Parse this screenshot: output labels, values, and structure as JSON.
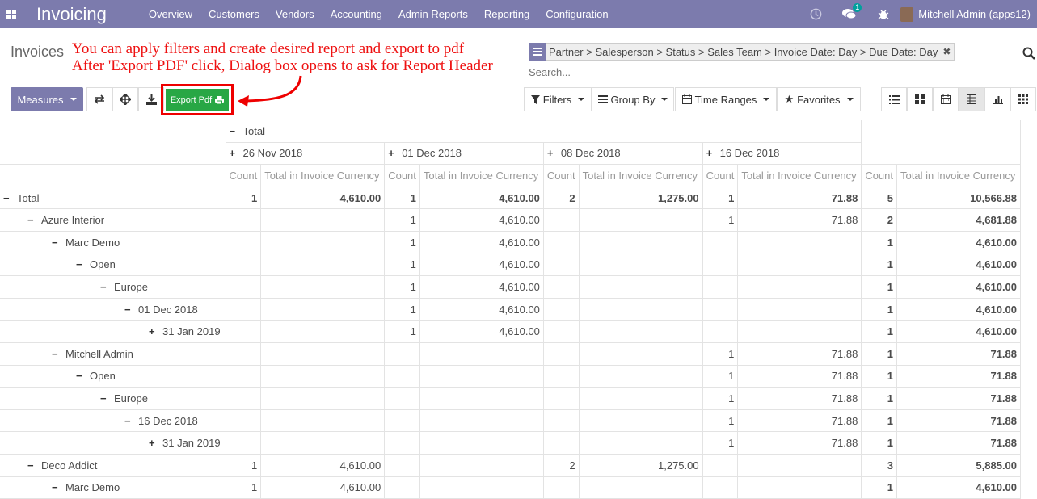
{
  "app": {
    "brand": "Invoicing",
    "menu": [
      "Overview",
      "Customers",
      "Vendors",
      "Accounting",
      "Admin Reports",
      "Reporting",
      "Configuration"
    ],
    "message_badge": "1",
    "user": "Mitchell Admin (apps12)"
  },
  "page": {
    "title": "Invoices",
    "annotation_line1": "You can apply filters and create desired report and export to pdf",
    "annotation_line2": "After 'Export PDF' click, Dialog box opens to ask for Report Header"
  },
  "search": {
    "facet": "Partner > Salesperson > Status > Sales Team > Invoice Date: Day > Due Date: Day",
    "placeholder": "Search..."
  },
  "toolbar": {
    "measures": "Measures",
    "export_pdf": "Export Pdf",
    "filters": "Filters",
    "group_by": "Group By",
    "time_ranges": "Time Ranges",
    "favorites": "Favorites"
  },
  "pivot": {
    "col_total": "Total",
    "col_groups": [
      "26 Nov 2018",
      "01 Dec 2018",
      "08 Dec 2018",
      "16 Dec 2018"
    ],
    "measure_count": "Count",
    "measure_total": "Total in Invoice Currency",
    "rows": [
      {
        "label": "Total",
        "indent": 0,
        "sign": "−",
        "bold": true,
        "cells": [
          "1",
          "4,610.00",
          "1",
          "4,610.00",
          "2",
          "1,275.00",
          "1",
          "71.88",
          "5",
          "10,566.88"
        ]
      },
      {
        "label": "Azure Interior",
        "indent": 1,
        "sign": "−",
        "bold": false,
        "cells": [
          "",
          "",
          "1",
          "4,610.00",
          "",
          "",
          "1",
          "71.88",
          "2",
          "4,681.88"
        ]
      },
      {
        "label": "Marc Demo",
        "indent": 2,
        "sign": "−",
        "bold": false,
        "cells": [
          "",
          "",
          "1",
          "4,610.00",
          "",
          "",
          "",
          "",
          "1",
          "4,610.00"
        ]
      },
      {
        "label": "Open",
        "indent": 3,
        "sign": "−",
        "bold": false,
        "cells": [
          "",
          "",
          "1",
          "4,610.00",
          "",
          "",
          "",
          "",
          "1",
          "4,610.00"
        ]
      },
      {
        "label": "Europe",
        "indent": 4,
        "sign": "−",
        "bold": false,
        "cells": [
          "",
          "",
          "1",
          "4,610.00",
          "",
          "",
          "",
          "",
          "1",
          "4,610.00"
        ]
      },
      {
        "label": "01 Dec 2018",
        "indent": 5,
        "sign": "−",
        "bold": false,
        "cells": [
          "",
          "",
          "1",
          "4,610.00",
          "",
          "",
          "",
          "",
          "1",
          "4,610.00"
        ]
      },
      {
        "label": "31 Jan 2019",
        "indent": 6,
        "sign": "+",
        "bold": false,
        "cells": [
          "",
          "",
          "1",
          "4,610.00",
          "",
          "",
          "",
          "",
          "1",
          "4,610.00"
        ]
      },
      {
        "label": "Mitchell Admin",
        "indent": 2,
        "sign": "−",
        "bold": false,
        "cells": [
          "",
          "",
          "",
          "",
          "",
          "",
          "1",
          "71.88",
          "1",
          "71.88"
        ]
      },
      {
        "label": "Open",
        "indent": 3,
        "sign": "−",
        "bold": false,
        "cells": [
          "",
          "",
          "",
          "",
          "",
          "",
          "1",
          "71.88",
          "1",
          "71.88"
        ]
      },
      {
        "label": "Europe",
        "indent": 4,
        "sign": "−",
        "bold": false,
        "cells": [
          "",
          "",
          "",
          "",
          "",
          "",
          "1",
          "71.88",
          "1",
          "71.88"
        ]
      },
      {
        "label": "16 Dec 2018",
        "indent": 5,
        "sign": "−",
        "bold": false,
        "cells": [
          "",
          "",
          "",
          "",
          "",
          "",
          "1",
          "71.88",
          "1",
          "71.88"
        ]
      },
      {
        "label": "31 Jan 2019",
        "indent": 6,
        "sign": "+",
        "bold": false,
        "cells": [
          "",
          "",
          "",
          "",
          "",
          "",
          "1",
          "71.88",
          "1",
          "71.88"
        ]
      },
      {
        "label": "Deco Addict",
        "indent": 1,
        "sign": "−",
        "bold": false,
        "cells": [
          "1",
          "4,610.00",
          "",
          "",
          "2",
          "1,275.00",
          "",
          "",
          "3",
          "5,885.00"
        ]
      },
      {
        "label": "Marc Demo",
        "indent": 2,
        "sign": "−",
        "bold": false,
        "cells": [
          "1",
          "4,610.00",
          "",
          "",
          "",
          "",
          "",
          "",
          "1",
          "4,610.00"
        ]
      }
    ]
  },
  "colors": {
    "navbar": "#7c7bad",
    "annotation": "#ee1111",
    "export_button": "#28a745"
  }
}
